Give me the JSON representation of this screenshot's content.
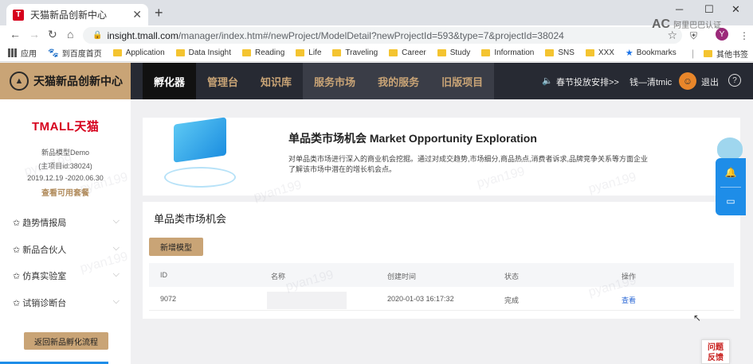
{
  "browser": {
    "tab_title": "天猫新品创新中心",
    "url_host": "insight.tmall.com",
    "url_path": "/manager/index.htm#/newProject/ModelDetail?newProjectId=593&type=7&projectId=38024",
    "brand_overlay": "阿里巴巴认证",
    "avatar_letter": "Y",
    "bookmarks": [
      {
        "label": "应用",
        "icon": "apps-icon"
      },
      {
        "label": "到百度首页",
        "icon": "baidu-icon"
      },
      {
        "label": "Application",
        "icon": "folder-icon"
      },
      {
        "label": "Data Insight",
        "icon": "folder-icon"
      },
      {
        "label": "Reading",
        "icon": "folder-icon"
      },
      {
        "label": "Life",
        "icon": "folder-icon"
      },
      {
        "label": "Traveling",
        "icon": "folder-icon"
      },
      {
        "label": "Career",
        "icon": "folder-icon"
      },
      {
        "label": "Study",
        "icon": "folder-icon"
      },
      {
        "label": "Information",
        "icon": "folder-icon"
      },
      {
        "label": "SNS",
        "icon": "folder-icon"
      },
      {
        "label": "XXX",
        "icon": "folder-icon"
      },
      {
        "label": "Bookmarks",
        "icon": "star-icon"
      }
    ],
    "other_bookmarks": "其他书签"
  },
  "header": {
    "logo_text": "天猫新品创新中心",
    "nav": [
      "孵化器",
      "管理台",
      "知识库",
      "服务市场",
      "我的服务",
      "旧版项目"
    ],
    "notice": "春节投放安排>>",
    "user": "钱—清tmic",
    "logout": "退出",
    "help": "?"
  },
  "sidebar": {
    "brand": "TMALL天猫",
    "model_name": "新品模型Demo",
    "project_id": "(主项目id:38024)",
    "date_range": "2019.12.19 -2020.06.30",
    "view_package": "查看可用套餐",
    "menu": [
      "趋势情报局",
      "新品合伙人",
      "仿真实验室",
      "试销诊断台"
    ],
    "back_button": "返回新品孵化流程"
  },
  "main": {
    "hero_title": "单品类市场机会 Market Opportunity Exploration",
    "hero_desc": "对单品类市场进行深入的商业机会挖掘。通过对成交趋势,市场细分,商品热点,消费者诉求,品牌竞争关系等方面企业了解该市场中潜在的增长机会点。",
    "section_title": "单品类市场机会",
    "new_model_button": "新增模型",
    "table": {
      "headers": [
        "ID",
        "名称",
        "创建时间",
        "状态",
        "操作"
      ],
      "rows": [
        {
          "id": "9072",
          "name": "",
          "created": "2020-01-03 16:17:32",
          "status": "完成",
          "action": "查看"
        }
      ]
    }
  },
  "watermark": "pyan199\n3",
  "feedback": "问题\n反馈"
}
